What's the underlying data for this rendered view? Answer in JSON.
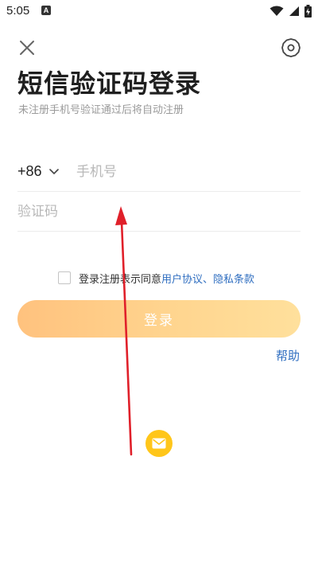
{
  "status_bar": {
    "time": "5:05",
    "app_indicator": "A",
    "icons": [
      "wifi-icon",
      "cell-signal-icon",
      "battery-charging-icon"
    ]
  },
  "header": {
    "close_icon": "close-icon",
    "settings_icon": "gear-icon"
  },
  "title": "短信验证码登录",
  "subtitle": "未注册手机号验证通过后将自动注册",
  "phone": {
    "country_code": "+86",
    "placeholder": "手机号",
    "value": ""
  },
  "verification": {
    "placeholder": "验证码",
    "value": ""
  },
  "agreement": {
    "checked": false,
    "prefix": "登录注册表示同意",
    "user_agreement": "用户协议",
    "separator": "、",
    "privacy_policy": "隐私条款"
  },
  "login_button": "登录",
  "help": "帮助",
  "floating_button_icon": "mail-icon",
  "colors": {
    "button_gradient_start": "#ffc27e",
    "button_gradient_end": "#ffe09c",
    "link": "#2f6ec0",
    "fab": "#ffc61a",
    "annotation_arrow": "#e0202a"
  }
}
